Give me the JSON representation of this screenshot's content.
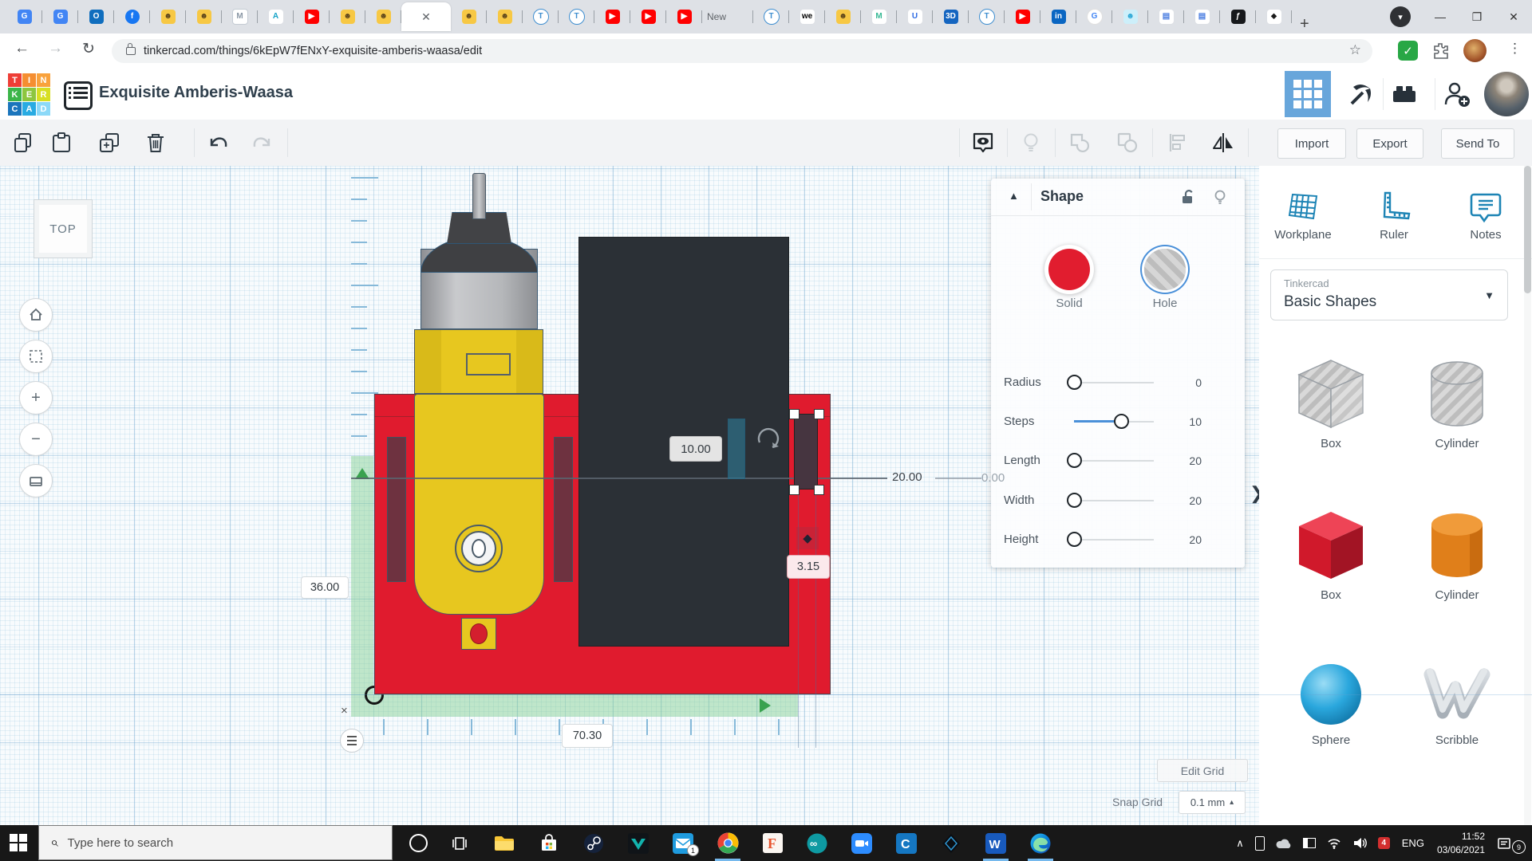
{
  "browser": {
    "tabs": [
      {
        "kind": "pin",
        "glyph": "G",
        "bg": "#4285f4",
        "fg": "#ffffff",
        "shape": "sq"
      },
      {
        "kind": "pin",
        "glyph": "G",
        "bg": "#4285f4",
        "fg": "#ffffff",
        "shape": "sq"
      },
      {
        "kind": "pin",
        "glyph": "O",
        "bg": "#106ebe",
        "fg": "#ffffff",
        "shape": "sq",
        "dot": "#e74c3c"
      },
      {
        "kind": "pin",
        "glyph": "f",
        "bg": "#1877f2",
        "fg": "#ffffff",
        "shape": "circle"
      },
      {
        "kind": "pin",
        "glyph": "☻",
        "bg": "#f7c844",
        "fg": "#5a421a",
        "shape": "sq"
      },
      {
        "kind": "pin",
        "glyph": "☻",
        "bg": "#f7c844",
        "fg": "#5a421a",
        "shape": "sq"
      },
      {
        "kind": "pin",
        "glyph": "M",
        "bg": "#ffffff",
        "fg": "#8a97a5",
        "shape": "sq",
        "border": "#c5ccd4"
      },
      {
        "kind": "pin",
        "glyph": "A",
        "bg": "#ffffff",
        "fg": "#15a3c7",
        "shape": "sq"
      },
      {
        "kind": "pin",
        "glyph": "▶",
        "bg": "#ff0000",
        "fg": "#ffffff",
        "shape": "sq"
      },
      {
        "kind": "pin",
        "glyph": "☻",
        "bg": "#f7c844",
        "fg": "#5a421a",
        "shape": "sq"
      },
      {
        "kind": "pin",
        "glyph": "☻",
        "bg": "#f7c844",
        "fg": "#5a421a",
        "shape": "sq"
      },
      {
        "kind": "active"
      },
      {
        "kind": "pin",
        "glyph": "☻",
        "bg": "#f7c844",
        "fg": "#5a421a",
        "shape": "sq"
      },
      {
        "kind": "pin",
        "glyph": "☻",
        "bg": "#f7c844",
        "fg": "#5a421a",
        "shape": "sq"
      },
      {
        "kind": "pin",
        "glyph": "T",
        "bg": "#ffffff",
        "fg": "#3e8ed0",
        "shape": "circle",
        "border": "#3e8ed0"
      },
      {
        "kind": "pin",
        "glyph": "T",
        "bg": "#ffffff",
        "fg": "#3e8ed0",
        "shape": "circle",
        "border": "#3e8ed0"
      },
      {
        "kind": "pin",
        "glyph": "▶",
        "bg": "#ff0000",
        "fg": "#ffffff",
        "shape": "sq"
      },
      {
        "kind": "pin",
        "glyph": "▶",
        "bg": "#ff0000",
        "fg": "#ffffff",
        "shape": "sq"
      },
      {
        "kind": "pin",
        "glyph": "▶",
        "bg": "#ff0000",
        "fg": "#ffffff",
        "shape": "sq"
      },
      {
        "kind": "text",
        "label": "New"
      },
      {
        "kind": "pin",
        "glyph": "T",
        "bg": "#ffffff",
        "fg": "#3e8ed0",
        "shape": "circle",
        "border": "#3e8ed0"
      },
      {
        "kind": "pin",
        "glyph": "we",
        "bg": "#ffffff",
        "fg": "#000000",
        "shape": "sq"
      },
      {
        "kind": "pin",
        "glyph": "☻",
        "bg": "#f7c844",
        "fg": "#5a421a",
        "shape": "sq"
      },
      {
        "kind": "pin",
        "glyph": "M",
        "bg": "#ffffff",
        "fg": "#35b894",
        "shape": "sq"
      },
      {
        "kind": "pin",
        "glyph": "U",
        "bg": "#ffffff",
        "fg": "#2d6ae3",
        "shape": "sq"
      },
      {
        "kind": "pin",
        "glyph": "3D",
        "bg": "#1565c0",
        "fg": "#ffffff",
        "shape": "sq"
      },
      {
        "kind": "pin",
        "glyph": "T",
        "bg": "#ffffff",
        "fg": "#3e8ed0",
        "shape": "circle",
        "border": "#3e8ed0"
      },
      {
        "kind": "pin",
        "glyph": "▶",
        "bg": "#ff0000",
        "fg": "#ffffff",
        "shape": "sq"
      },
      {
        "kind": "pin",
        "glyph": "in",
        "bg": "#0a66c2",
        "fg": "#ffffff",
        "shape": "sq",
        "dot": "#e74c3c"
      },
      {
        "kind": "pin",
        "glyph": "G",
        "bg": "#ffffff",
        "fg": "#4285f4",
        "shape": "circle",
        "border": "#e0e0e0"
      },
      {
        "kind": "pin",
        "glyph": "☻",
        "bg": "#cdeffa",
        "fg": "#2aa7d6",
        "shape": "sq"
      },
      {
        "kind": "pin",
        "glyph": "▤",
        "bg": "#ffffff",
        "fg": "#4a7de0",
        "shape": "sq"
      },
      {
        "kind": "pin",
        "glyph": "▤",
        "bg": "#ffffff",
        "fg": "#4a7de0",
        "shape": "sq"
      },
      {
        "kind": "pin",
        "glyph": "ƒ",
        "bg": "#17191c",
        "fg": "#ffffff",
        "shape": "sq"
      },
      {
        "kind": "pin",
        "glyph": "⬥",
        "bg": "#ffffff",
        "fg": "#1a1a1a",
        "shape": "sq"
      }
    ],
    "active_tab_close": "✕",
    "new_tab_button": "+",
    "profile_caret": "▾",
    "window_controls": {
      "minimize": "—",
      "maximize": "❐",
      "close": "✕"
    },
    "nav": {
      "back": "←",
      "forward": "→",
      "reload": "↻"
    },
    "url": "tinkercad.com/things/6kEpW7fENxY-exquisite-amberis-waasa/edit",
    "star": "☆",
    "menu": "⋮",
    "ext_check": "✓"
  },
  "header": {
    "logo_letters": [
      "T",
      "I",
      "N",
      "K",
      "E",
      "R",
      "C",
      "A",
      "D"
    ],
    "logo_colors": [
      "#ee3e36",
      "#f58e31",
      "#f9a23c",
      "#3cb549",
      "#8dc63f",
      "#d7df23",
      "#1b75bc",
      "#29abe2",
      "#8cd9f8"
    ],
    "title": "Exquisite Amberis-Waasa"
  },
  "toolbar": {
    "import": "Import",
    "export": "Export",
    "send_to": "Send To"
  },
  "canvas": {
    "view_label": "TOP",
    "dim_width_inner": "10.00",
    "dim_len": "20.00",
    "dim_zero": "0.00",
    "dim_gap": "3.15",
    "dim_height_side": "36.00",
    "dim_total": "70.30",
    "ruler_close": "×"
  },
  "shape_panel": {
    "title": "Shape",
    "collapse": "▲",
    "solid_label": "Solid",
    "hole_label": "Hole",
    "sliders": [
      {
        "label": "Radius",
        "value": "0"
      },
      {
        "label": "Steps",
        "value": "10"
      },
      {
        "label": "Length",
        "value": "20"
      },
      {
        "label": "Width",
        "value": "20"
      },
      {
        "label": "Height",
        "value": "20"
      }
    ],
    "expand_chevron": "❯"
  },
  "sidebar": {
    "tools": [
      {
        "label": "Workplane"
      },
      {
        "label": "Ruler"
      },
      {
        "label": "Notes"
      }
    ],
    "library_label": "Tinkercad",
    "library_value": "Basic Shapes",
    "caret": "▼",
    "shapes": [
      {
        "name": "Box",
        "variant": "hole-box"
      },
      {
        "name": "Cylinder",
        "variant": "hole-cyl"
      },
      {
        "name": "Box",
        "variant": "red-box"
      },
      {
        "name": "Cylinder",
        "variant": "orange-cyl"
      },
      {
        "name": "Sphere",
        "variant": "sphere"
      },
      {
        "name": "Scribble",
        "variant": "scribble"
      }
    ]
  },
  "grid_controls": {
    "edit_grid": "Edit Grid",
    "snap_label": "Snap Grid",
    "snap_value": "0.1 mm",
    "snap_caret": "▴"
  },
  "taskbar": {
    "search_placeholder": "Type here to search",
    "apps": [
      {
        "icon": "folder",
        "active": false
      },
      {
        "icon": "store",
        "active": false
      },
      {
        "icon": "steam",
        "active": false
      },
      {
        "icon": "predator",
        "active": false
      },
      {
        "icon": "mail",
        "active": false,
        "badge": "1"
      },
      {
        "icon": "chrome",
        "active": true
      },
      {
        "icon": "fusion",
        "active": false
      },
      {
        "icon": "arduino",
        "active": false
      },
      {
        "icon": "zoom",
        "active": false
      },
      {
        "icon": "cura",
        "active": false
      },
      {
        "icon": "diamond",
        "active": false
      },
      {
        "icon": "word",
        "active": true
      },
      {
        "icon": "edge",
        "active": true
      }
    ],
    "tray_badge_4": "4",
    "language": "ENG",
    "time": "11:52",
    "date": "03/06/2021",
    "notif_count": "9"
  }
}
